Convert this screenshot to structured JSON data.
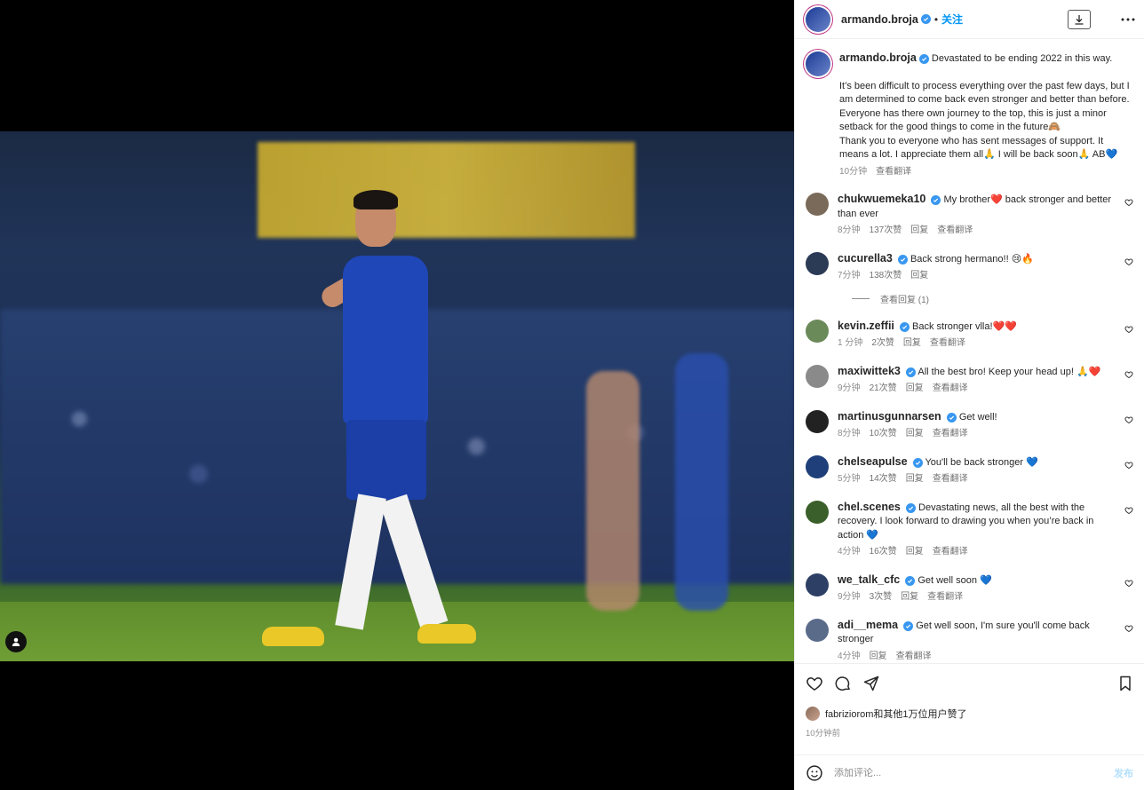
{
  "post": {
    "author": "armando.broja",
    "follow_label": "关注",
    "dot": "•",
    "caption": {
      "lines": [
        "Devastated to be ending 2022 in this way.",
        "It’s been difficult to process everything over the past few days, but I am determined to come back even stronger and better than before.",
        "Everyone has there own journey to the top, this is just a minor setback for the good things to come in the future🙈",
        "Thank you to everyone who has sent messages of support. It means a lot. I appreciate them all🙏 I will be back soon🙏 AB💙"
      ],
      "time": "10分钟",
      "translate": "查看翻译"
    },
    "likes_text": "fabriziorom和其他1万位用户赞了",
    "posted_time": "10分钟前",
    "comment_placeholder": "添加评论...",
    "post_label": "发布"
  },
  "comments": [
    {
      "user": "chukwuemeka10",
      "text": "My brother❤️ back stronger and better than ever",
      "time": "8分钟",
      "likes": "137次赞",
      "reply": "回复",
      "translate": "查看翻译"
    },
    {
      "user": "cucurella3",
      "text": "Back strong hermano!! 😢🔥",
      "time": "7分钟",
      "likes": "138次赞",
      "reply": "回复",
      "translate": "",
      "view_replies": "查看回复 (1)"
    },
    {
      "user": "kevin.zeffii",
      "text": "Back stronger vlla!❤️❤️",
      "time": "1 分钟",
      "likes": "2次赞",
      "reply": "回复",
      "translate": "查看翻译"
    },
    {
      "user": "maxiwittek3",
      "text": "All the best bro! Keep your head up! 🙏❤️",
      "time": "9分钟",
      "likes": "21次赞",
      "reply": "回复",
      "translate": "查看翻译"
    },
    {
      "user": "martinusgunnarsen",
      "text": "Get well!",
      "time": "8分钟",
      "likes": "10次赞",
      "reply": "回复",
      "translate": "查看翻译"
    },
    {
      "user": "chelseapulse",
      "text": "You'll be back stronger 💙",
      "time": "5分钟",
      "likes": "14次赞",
      "reply": "回复",
      "translate": "查看翻译"
    },
    {
      "user": "chel.scenes",
      "text": "Devastating news, all the best with the recovery. I look forward to drawing you when you’re back in action 💙",
      "time": "4分钟",
      "likes": "16次赞",
      "reply": "回复",
      "translate": "查看翻译"
    },
    {
      "user": "we_talk_cfc",
      "text": "Get well soon 💙",
      "time": "9分钟",
      "likes": "3次赞",
      "reply": "回复",
      "translate": "查看翻译"
    },
    {
      "user": "adi__mema",
      "text": "Get well soon, I'm sure you'll come back stronger",
      "time": "4分钟",
      "likes": "",
      "reply": "回复",
      "translate": "查看翻译"
    }
  ],
  "colors": {
    "link": "#0095f6",
    "verified": "#3897f0",
    "heart": "#ed4956"
  },
  "icons": [
    "user-tag-icon",
    "download-icon",
    "more-icon",
    "heart-icon",
    "comment-icon",
    "share-icon",
    "bookmark-icon",
    "emoji-icon",
    "verified-icon"
  ]
}
